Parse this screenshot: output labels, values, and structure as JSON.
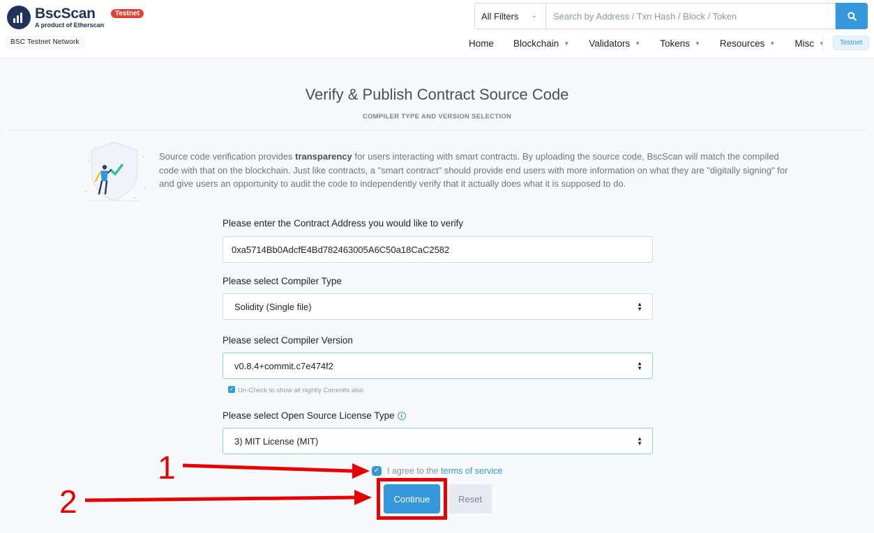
{
  "header": {
    "logo_title": "BscScan",
    "logo_subtitle": "A product of Etherscan",
    "testnet_badge": "Testnet",
    "network_label": "BSC Testnet Network",
    "filter_value": "All Filters",
    "search_placeholder": "Search by Address / Txn Hash / Block / Token",
    "nav": [
      {
        "label": "Home"
      },
      {
        "label": "Blockchain"
      },
      {
        "label": "Validators"
      },
      {
        "label": "Tokens"
      },
      {
        "label": "Resources"
      },
      {
        "label": "Misc"
      }
    ],
    "nav_testnet": "Testnet"
  },
  "page": {
    "title": "Verify & Publish Contract Source Code",
    "subtitle": "COMPILER TYPE AND VERSION SELECTION",
    "intro_pre": "Source code verification provides ",
    "intro_bold": "transparency",
    "intro_post": " for users interacting with smart contracts. By uploading the source code, BscScan will match the compiled code with that on the blockchain. Just like contracts, a \"smart contract\" should provide end users with more information on what they are \"digitally signing\" for and give users an opportunity to audit the code to independently verify that it actually does what it is supposed to do."
  },
  "form": {
    "address_label": "Please enter the Contract Address you would like to verify",
    "address_value": "0xa5714Bb0AdcfE4Bd782463005A6C50a18CaC2582",
    "compiler_type_label": "Please select Compiler Type",
    "compiler_type_value": "Solidity (Single file)",
    "compiler_version_label": "Please select Compiler Version",
    "compiler_version_value": "v0.8.4+commit.c7e474f2",
    "nightly_label": "Un-Check to show all nightly Commits also",
    "license_label": "Please select Open Source License Type",
    "license_value": "3) MIT License (MIT)",
    "agree_pre": "I agree to the ",
    "agree_link": "terms of service",
    "continue_label": "Continue",
    "reset_label": "Reset"
  },
  "annotations": {
    "label_1": "1",
    "label_2": "2"
  },
  "colors": {
    "accent": "#3498db",
    "annotation": "#e60000",
    "testnet_badge": "#de4437"
  }
}
